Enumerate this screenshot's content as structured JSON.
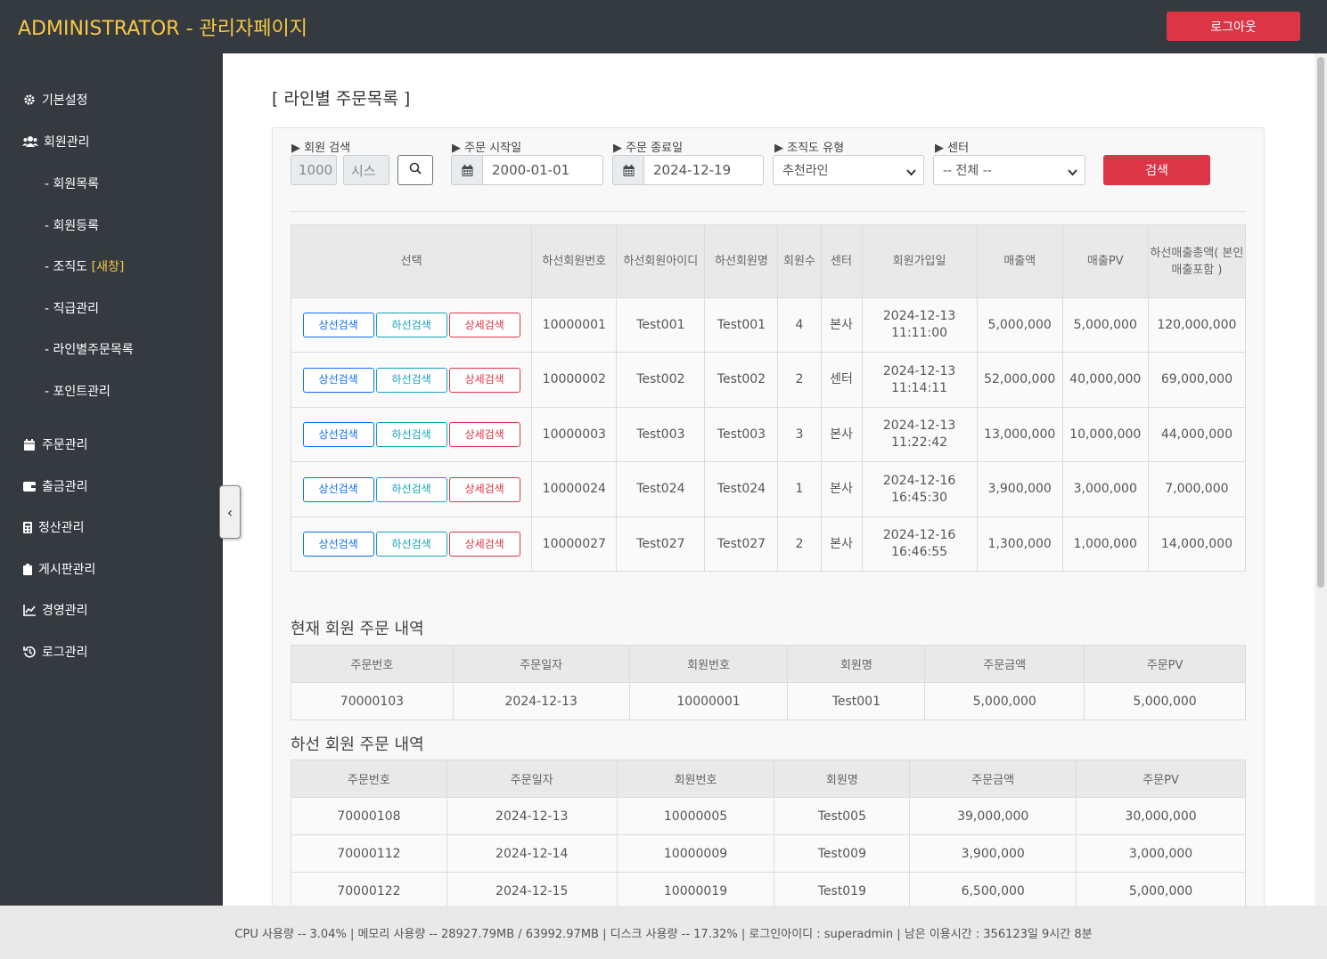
{
  "header": {
    "title": "ADMINISTRATOR - 관리자페이지",
    "logout_label": "로그아웃"
  },
  "sidebar": {
    "items": [
      {
        "label": "기본설정",
        "icon": "gear-icon"
      },
      {
        "label": "회원관리",
        "icon": "users-icon"
      },
      {
        "label": "주문관리",
        "icon": "calendar-icon"
      },
      {
        "label": "출금관리",
        "icon": "wallet-icon"
      },
      {
        "label": "정산관리",
        "icon": "calculator-icon"
      },
      {
        "label": "게시판관리",
        "icon": "clipboard-icon"
      },
      {
        "label": "경영관리",
        "icon": "chart-line-icon"
      },
      {
        "label": "로그관리",
        "icon": "history-icon"
      }
    ],
    "sub_items": [
      "- 회원목록",
      "- 회원등록",
      "- 조직도",
      "- 직급관리",
      "- 라인별주문목록",
      "- 포인트관리"
    ],
    "new_window_tag": "[새창]",
    "toggle_glyph": "‹"
  },
  "page": {
    "title": "[ 라인별 주문목록 ]"
  },
  "filters": {
    "member_search_label": "▶ 회원 검색",
    "member_id_value": "1000",
    "member_name_value": "시스",
    "start_label": "▶ 주문 시작일",
    "start_value": "2000-01-01",
    "end_label": "▶ 주문 종료일",
    "end_value": "2024-12-19",
    "org_type_label": "▶ 조직도 유형",
    "org_type_value": "추천라인",
    "center_label": "▶ 센터",
    "center_value": "-- 전체 --",
    "search_button": "검색"
  },
  "main_table": {
    "headers": [
      "선택",
      "하선회원번호",
      "하선회원아이디",
      "하선회원명",
      "회원수",
      "센터",
      "회원가입일",
      "매출액",
      "매출PV",
      "하선매출총액( 본인매출포함 )"
    ],
    "buttons": {
      "up": "상선검색",
      "down": "하선검색",
      "detail": "상세검색"
    },
    "rows": [
      [
        "10000001",
        "Test001",
        "Test001",
        "4",
        "본사",
        "2024-12-13 11:11:00",
        "5,000,000",
        "5,000,000",
        "120,000,000"
      ],
      [
        "10000002",
        "Test002",
        "Test002",
        "2",
        "센터",
        "2024-12-13 11:14:11",
        "52,000,000",
        "40,000,000",
        "69,000,000"
      ],
      [
        "10000003",
        "Test003",
        "Test003",
        "3",
        "본사",
        "2024-12-13 11:22:42",
        "13,000,000",
        "10,000,000",
        "44,000,000"
      ],
      [
        "10000024",
        "Test024",
        "Test024",
        "1",
        "본사",
        "2024-12-16 16:45:30",
        "3,900,000",
        "3,000,000",
        "7,000,000"
      ],
      [
        "10000027",
        "Test027",
        "Test027",
        "2",
        "본사",
        "2024-12-16 16:46:55",
        "1,300,000",
        "1,000,000",
        "14,000,000"
      ]
    ]
  },
  "current_orders": {
    "title": "현재 회원 주문 내역",
    "headers": [
      "주문번호",
      "주문일자",
      "회원번호",
      "회원명",
      "주문금액",
      "주문PV"
    ],
    "rows": [
      [
        "70000103",
        "2024-12-13",
        "10000001",
        "Test001",
        "5,000,000",
        "5,000,000"
      ]
    ]
  },
  "lower_orders": {
    "title": "하선 회원 주문 내역",
    "headers": [
      "주문번호",
      "주문일자",
      "회원번호",
      "회원명",
      "주문금액",
      "주문PV"
    ],
    "rows": [
      [
        "70000108",
        "2024-12-13",
        "10000005",
        "Test005",
        "39,000,000",
        "30,000,000"
      ],
      [
        "70000112",
        "2024-12-14",
        "10000009",
        "Test009",
        "3,900,000",
        "3,000,000"
      ],
      [
        "70000122",
        "2024-12-15",
        "10000019",
        "Test019",
        "6,500,000",
        "5,000,000"
      ]
    ]
  },
  "footer": {
    "text": "CPU 사용량 -- 3.04% | 메모리 사용량 -- 28927.79MB / 63992.97MB | 디스크 사용량 -- 17.32%  |   로그인아이디 : superadmin  |   남은 이용시간 : 356123일 9시간 8분"
  }
}
